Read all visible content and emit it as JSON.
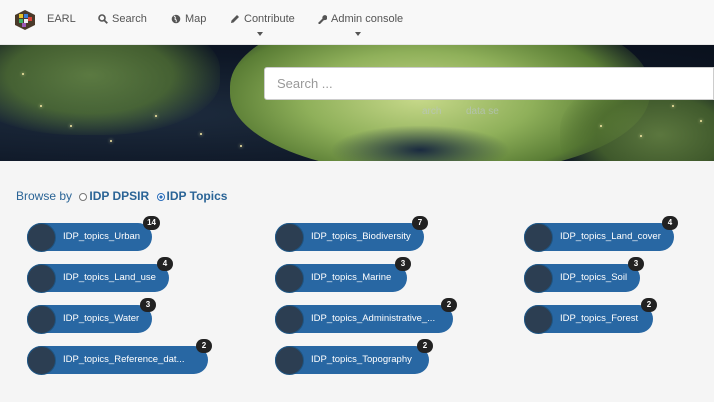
{
  "navbar": {
    "brand": "EARL",
    "items": [
      {
        "label": "Search",
        "icon": "search-icon"
      },
      {
        "label": "Map",
        "icon": "globe-icon"
      },
      {
        "label": "Contribute",
        "icon": "pencil-icon"
      },
      {
        "label": "Admin console",
        "icon": "wrench-icon"
      }
    ]
  },
  "hero": {
    "search_placeholder": "Search ...",
    "ghost_texts": [
      "arch",
      "data se"
    ]
  },
  "browse": {
    "prefix": "Browse by",
    "options": [
      {
        "label": "IDP DPSIR",
        "selected": false
      },
      {
        "label": "IDP Topics",
        "selected": true
      }
    ]
  },
  "topics": [
    {
      "label": "IDP_topics_Urban",
      "count": "14"
    },
    {
      "label": "IDP_topics_Biodiversity",
      "count": "7"
    },
    {
      "label": "IDP_topics_Land_cover",
      "count": "4"
    },
    {
      "label": "IDP_topics_Land_use",
      "count": "4"
    },
    {
      "label": "IDP_topics_Marine",
      "count": "3"
    },
    {
      "label": "IDP_topics_Soil",
      "count": "3"
    },
    {
      "label": "IDP_topics_Water",
      "count": "3"
    },
    {
      "label": "IDP_topics_Administrative_...",
      "count": "2"
    },
    {
      "label": "IDP_topics_Forest",
      "count": "2"
    },
    {
      "label": "IDP_topics_Reference_dat...",
      "count": "2"
    },
    {
      "label": "IDP_topics_Topography",
      "count": "2"
    }
  ],
  "colors": {
    "accent": "#2867a3",
    "link": "#2a6496",
    "badge": "#222222"
  }
}
